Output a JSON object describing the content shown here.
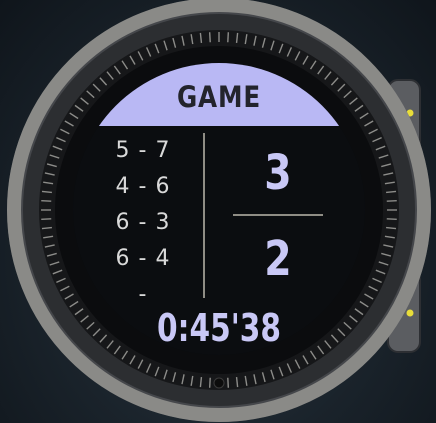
{
  "header": {
    "title": "GAME"
  },
  "sets": [
    {
      "score": "5 - 7"
    },
    {
      "score": "4 - 6"
    },
    {
      "score": "6 - 3"
    },
    {
      "score": "6 - 4"
    },
    {
      "score": "-"
    }
  ],
  "current_game": {
    "player_score": "3",
    "opponent_score": "2"
  },
  "timer": {
    "elapsed": "0:45'38"
  },
  "colors": {
    "accent": "#b9b8f4",
    "score_text": "#c9c8f6",
    "set_text": "#d9d9d9"
  }
}
